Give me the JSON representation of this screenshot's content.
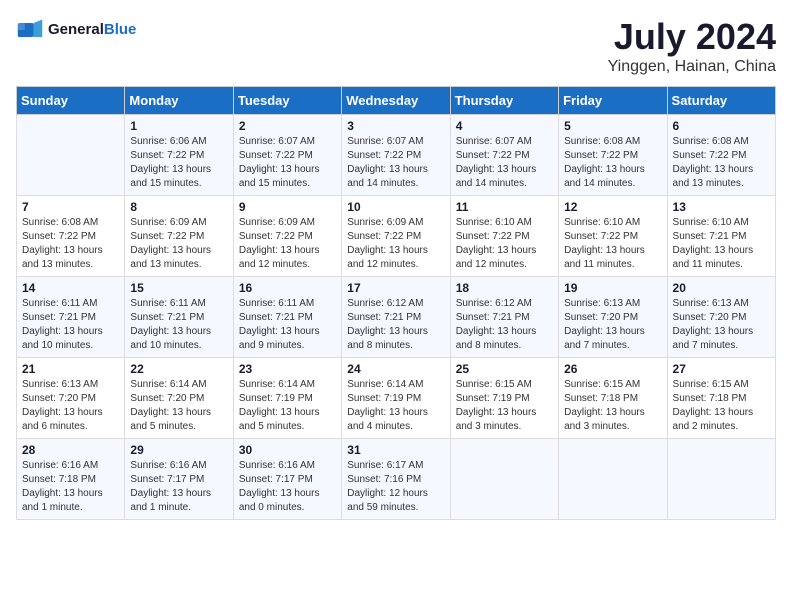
{
  "header": {
    "logo_general": "General",
    "logo_blue": "Blue",
    "month_year": "July 2024",
    "location": "Yinggen, Hainan, China"
  },
  "days_of_week": [
    "Sunday",
    "Monday",
    "Tuesday",
    "Wednesday",
    "Thursday",
    "Friday",
    "Saturday"
  ],
  "weeks": [
    [
      {
        "day": "",
        "info": ""
      },
      {
        "day": "1",
        "info": "Sunrise: 6:06 AM\nSunset: 7:22 PM\nDaylight: 13 hours\nand 15 minutes."
      },
      {
        "day": "2",
        "info": "Sunrise: 6:07 AM\nSunset: 7:22 PM\nDaylight: 13 hours\nand 15 minutes."
      },
      {
        "day": "3",
        "info": "Sunrise: 6:07 AM\nSunset: 7:22 PM\nDaylight: 13 hours\nand 14 minutes."
      },
      {
        "day": "4",
        "info": "Sunrise: 6:07 AM\nSunset: 7:22 PM\nDaylight: 13 hours\nand 14 minutes."
      },
      {
        "day": "5",
        "info": "Sunrise: 6:08 AM\nSunset: 7:22 PM\nDaylight: 13 hours\nand 14 minutes."
      },
      {
        "day": "6",
        "info": "Sunrise: 6:08 AM\nSunset: 7:22 PM\nDaylight: 13 hours\nand 13 minutes."
      }
    ],
    [
      {
        "day": "7",
        "info": "Sunrise: 6:08 AM\nSunset: 7:22 PM\nDaylight: 13 hours\nand 13 minutes."
      },
      {
        "day": "8",
        "info": "Sunrise: 6:09 AM\nSunset: 7:22 PM\nDaylight: 13 hours\nand 13 minutes."
      },
      {
        "day": "9",
        "info": "Sunrise: 6:09 AM\nSunset: 7:22 PM\nDaylight: 13 hours\nand 12 minutes."
      },
      {
        "day": "10",
        "info": "Sunrise: 6:09 AM\nSunset: 7:22 PM\nDaylight: 13 hours\nand 12 minutes."
      },
      {
        "day": "11",
        "info": "Sunrise: 6:10 AM\nSunset: 7:22 PM\nDaylight: 13 hours\nand 12 minutes."
      },
      {
        "day": "12",
        "info": "Sunrise: 6:10 AM\nSunset: 7:22 PM\nDaylight: 13 hours\nand 11 minutes."
      },
      {
        "day": "13",
        "info": "Sunrise: 6:10 AM\nSunset: 7:21 PM\nDaylight: 13 hours\nand 11 minutes."
      }
    ],
    [
      {
        "day": "14",
        "info": "Sunrise: 6:11 AM\nSunset: 7:21 PM\nDaylight: 13 hours\nand 10 minutes."
      },
      {
        "day": "15",
        "info": "Sunrise: 6:11 AM\nSunset: 7:21 PM\nDaylight: 13 hours\nand 10 minutes."
      },
      {
        "day": "16",
        "info": "Sunrise: 6:11 AM\nSunset: 7:21 PM\nDaylight: 13 hours\nand 9 minutes."
      },
      {
        "day": "17",
        "info": "Sunrise: 6:12 AM\nSunset: 7:21 PM\nDaylight: 13 hours\nand 8 minutes."
      },
      {
        "day": "18",
        "info": "Sunrise: 6:12 AM\nSunset: 7:21 PM\nDaylight: 13 hours\nand 8 minutes."
      },
      {
        "day": "19",
        "info": "Sunrise: 6:13 AM\nSunset: 7:20 PM\nDaylight: 13 hours\nand 7 minutes."
      },
      {
        "day": "20",
        "info": "Sunrise: 6:13 AM\nSunset: 7:20 PM\nDaylight: 13 hours\nand 7 minutes."
      }
    ],
    [
      {
        "day": "21",
        "info": "Sunrise: 6:13 AM\nSunset: 7:20 PM\nDaylight: 13 hours\nand 6 minutes."
      },
      {
        "day": "22",
        "info": "Sunrise: 6:14 AM\nSunset: 7:20 PM\nDaylight: 13 hours\nand 5 minutes."
      },
      {
        "day": "23",
        "info": "Sunrise: 6:14 AM\nSunset: 7:19 PM\nDaylight: 13 hours\nand 5 minutes."
      },
      {
        "day": "24",
        "info": "Sunrise: 6:14 AM\nSunset: 7:19 PM\nDaylight: 13 hours\nand 4 minutes."
      },
      {
        "day": "25",
        "info": "Sunrise: 6:15 AM\nSunset: 7:19 PM\nDaylight: 13 hours\nand 3 minutes."
      },
      {
        "day": "26",
        "info": "Sunrise: 6:15 AM\nSunset: 7:18 PM\nDaylight: 13 hours\nand 3 minutes."
      },
      {
        "day": "27",
        "info": "Sunrise: 6:15 AM\nSunset: 7:18 PM\nDaylight: 13 hours\nand 2 minutes."
      }
    ],
    [
      {
        "day": "28",
        "info": "Sunrise: 6:16 AM\nSunset: 7:18 PM\nDaylight: 13 hours\nand 1 minute."
      },
      {
        "day": "29",
        "info": "Sunrise: 6:16 AM\nSunset: 7:17 PM\nDaylight: 13 hours\nand 1 minute."
      },
      {
        "day": "30",
        "info": "Sunrise: 6:16 AM\nSunset: 7:17 PM\nDaylight: 13 hours\nand 0 minutes."
      },
      {
        "day": "31",
        "info": "Sunrise: 6:17 AM\nSunset: 7:16 PM\nDaylight: 12 hours\nand 59 minutes."
      },
      {
        "day": "",
        "info": ""
      },
      {
        "day": "",
        "info": ""
      },
      {
        "day": "",
        "info": ""
      }
    ]
  ]
}
